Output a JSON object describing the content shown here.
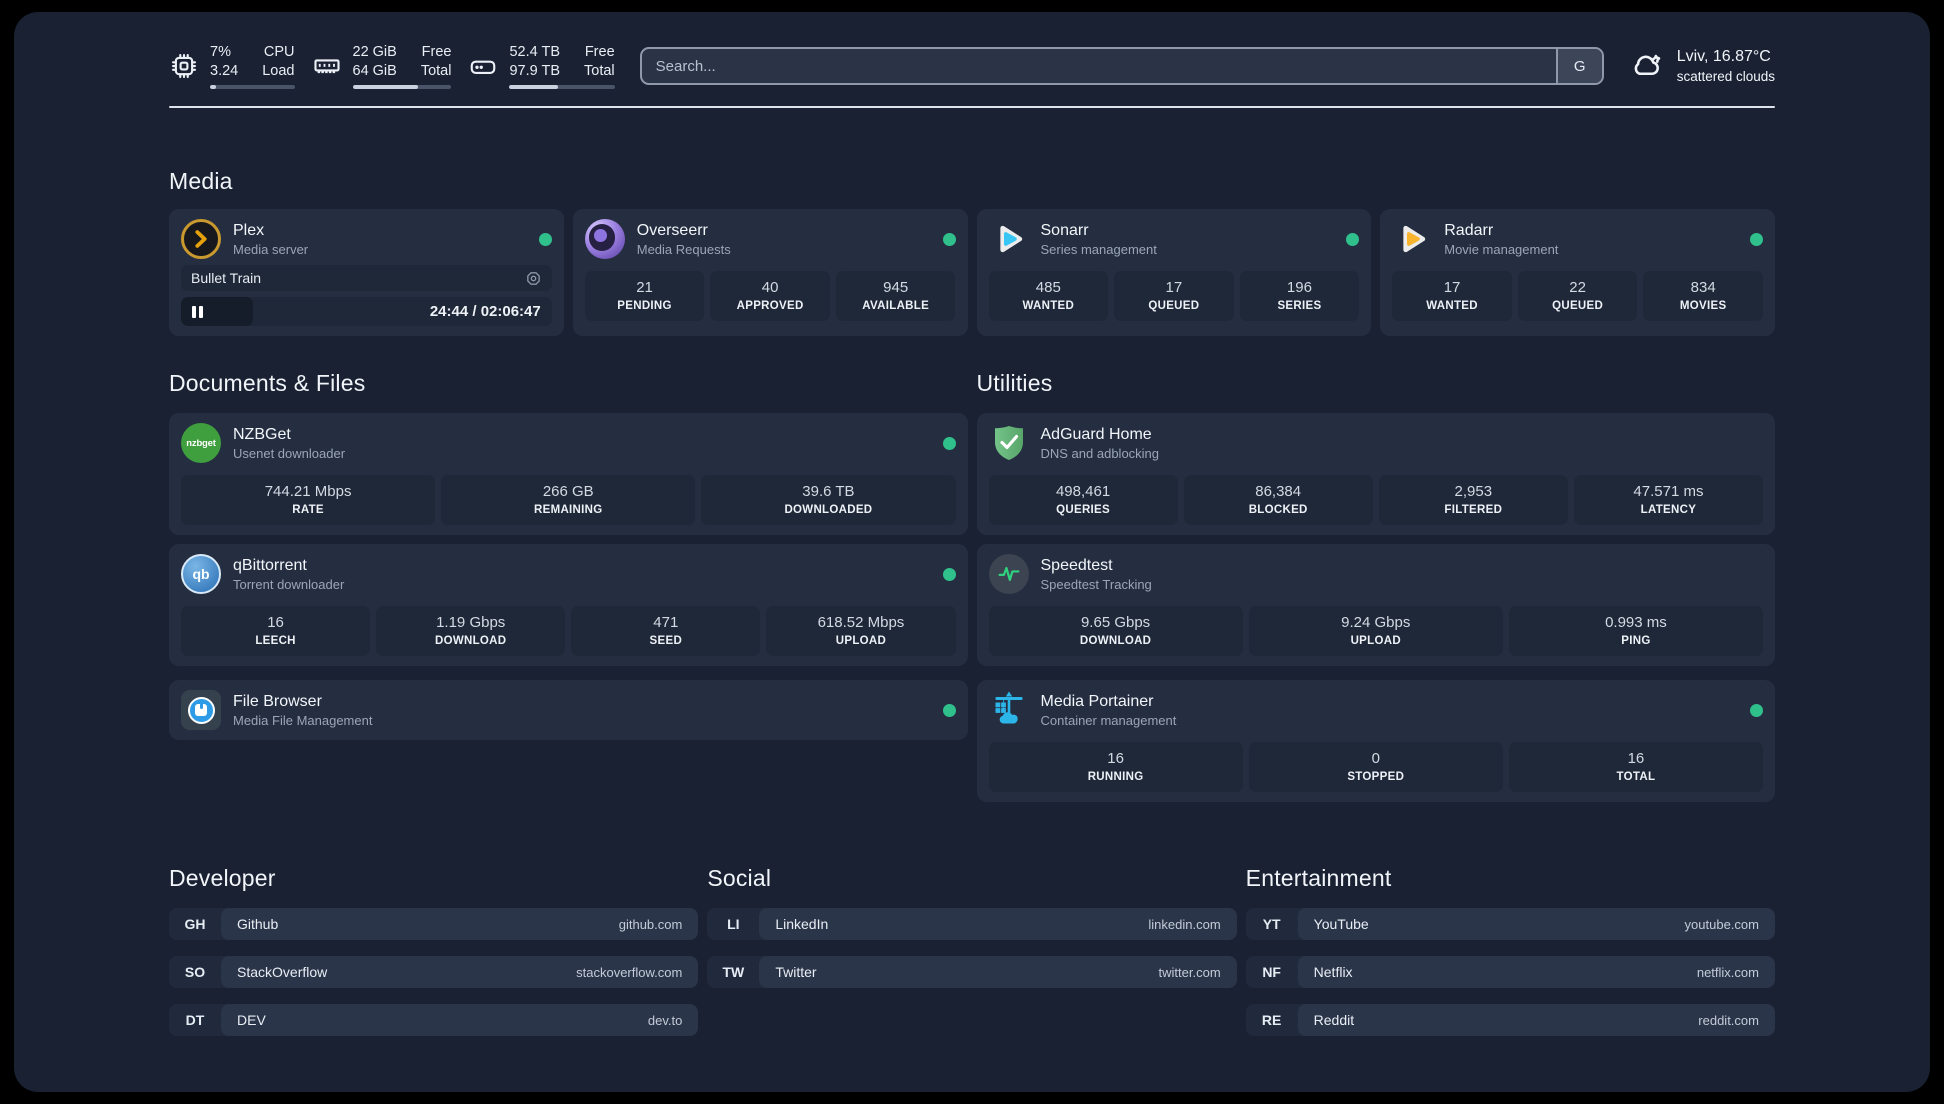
{
  "colors": {
    "status_online": "#2fc08c"
  },
  "header": {
    "stats": [
      {
        "icon": "cpu-icon",
        "values": [
          "7%",
          "3.24"
        ],
        "labels": [
          "CPU",
          "Load"
        ],
        "progress_percent": 7
      },
      {
        "icon": "memory-icon",
        "values": [
          "22 GiB",
          "64 GiB"
        ],
        "labels": [
          "Free",
          "Total"
        ],
        "progress_percent": 66
      },
      {
        "icon": "disk-icon",
        "values": [
          "52.4 TB",
          "97.9 TB"
        ],
        "labels": [
          "Free",
          "Total"
        ],
        "progress_percent": 46
      }
    ],
    "search": {
      "placeholder": "Search...",
      "engine_button_label": "G"
    },
    "weather": {
      "location_temp": "Lviv, 16.87°C",
      "condition": "scattered clouds"
    }
  },
  "icons": {
    "nzbget_text": "nzbget",
    "qbittorrent_text": "qb"
  },
  "sections": {
    "media": {
      "title": "Media",
      "plex": {
        "title": "Plex",
        "subtitle": "Media server",
        "now_playing_title": "Bullet Train",
        "time": "24:44 / 02:06:47",
        "progress_percent": 19.5
      },
      "overseerr": {
        "title": "Overseerr",
        "subtitle": "Media Requests",
        "stats": [
          {
            "value": "21",
            "label": "PENDING"
          },
          {
            "value": "40",
            "label": "APPROVED"
          },
          {
            "value": "945",
            "label": "AVAILABLE"
          }
        ]
      },
      "sonarr": {
        "title": "Sonarr",
        "subtitle": "Series management",
        "stats": [
          {
            "value": "485",
            "label": "WANTED"
          },
          {
            "value": "17",
            "label": "QUEUED"
          },
          {
            "value": "196",
            "label": "SERIES"
          }
        ]
      },
      "radarr": {
        "title": "Radarr",
        "subtitle": "Movie management",
        "stats": [
          {
            "value": "17",
            "label": "WANTED"
          },
          {
            "value": "22",
            "label": "QUEUED"
          },
          {
            "value": "834",
            "label": "MOVIES"
          }
        ]
      }
    },
    "documents": {
      "title": "Documents & Files",
      "nzbget": {
        "title": "NZBGet",
        "subtitle": "Usenet downloader",
        "stats": [
          {
            "value": "744.21 Mbps",
            "label": "RATE"
          },
          {
            "value": "266 GB",
            "label": "REMAINING"
          },
          {
            "value": "39.6 TB",
            "label": "DOWNLOADED"
          }
        ]
      },
      "qbittorrent": {
        "title": "qBittorrent",
        "subtitle": "Torrent downloader",
        "stats": [
          {
            "value": "16",
            "label": "LEECH"
          },
          {
            "value": "1.19 Gbps",
            "label": "DOWNLOAD"
          },
          {
            "value": "471",
            "label": "SEED"
          },
          {
            "value": "618.52 Mbps",
            "label": "UPLOAD"
          }
        ]
      },
      "filebrowser": {
        "title": "File Browser",
        "subtitle": "Media File Management"
      }
    },
    "utilities": {
      "title": "Utilities",
      "adguard": {
        "title": "AdGuard Home",
        "subtitle": "DNS and adblocking",
        "stats": [
          {
            "value": "498,461",
            "label": "QUERIES"
          },
          {
            "value": "86,384",
            "label": "BLOCKED"
          },
          {
            "value": "2,953",
            "label": "FILTERED"
          },
          {
            "value": "47.571 ms",
            "label": "LATENCY"
          }
        ]
      },
      "speedtest": {
        "title": "Speedtest",
        "subtitle": "Speedtest Tracking",
        "stats": [
          {
            "value": "9.65 Gbps",
            "label": "DOWNLOAD"
          },
          {
            "value": "9.24 Gbps",
            "label": "UPLOAD"
          },
          {
            "value": "0.993 ms",
            "label": "PING"
          }
        ]
      },
      "portainer": {
        "title": "Media Portainer",
        "subtitle": "Container management",
        "stats": [
          {
            "value": "16",
            "label": "RUNNING"
          },
          {
            "value": "0",
            "label": "STOPPED"
          },
          {
            "value": "16",
            "label": "TOTAL"
          }
        ]
      }
    },
    "links": {
      "developer": {
        "title": "Developer",
        "items": [
          {
            "tag": "GH",
            "name": "Github",
            "url": "github.com"
          },
          {
            "tag": "SO",
            "name": "StackOverflow",
            "url": "stackoverflow.com"
          },
          {
            "tag": "DT",
            "name": "DEV",
            "url": "dev.to"
          }
        ]
      },
      "social": {
        "title": "Social",
        "items": [
          {
            "tag": "LI",
            "name": "LinkedIn",
            "url": "linkedin.com"
          },
          {
            "tag": "TW",
            "name": "Twitter",
            "url": "twitter.com"
          }
        ]
      },
      "entertainment": {
        "title": "Entertainment",
        "items": [
          {
            "tag": "YT",
            "name": "YouTube",
            "url": "youtube.com"
          },
          {
            "tag": "NF",
            "name": "Netflix",
            "url": "netflix.com"
          },
          {
            "tag": "RE",
            "name": "Reddit",
            "url": "reddit.com"
          }
        ]
      }
    }
  }
}
